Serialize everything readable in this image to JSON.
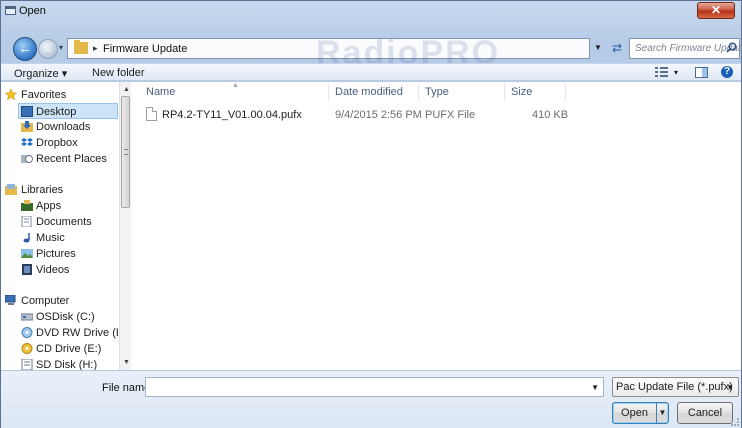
{
  "window": {
    "title": "Open",
    "close_label": "✕"
  },
  "address": {
    "sep": "▸",
    "path": "Firmware Update",
    "watermark": "RadioPRO"
  },
  "search": {
    "placeholder": "Search Firmware Update"
  },
  "toolbar": {
    "organize_label": "Organize ▾",
    "new_folder_label": "New folder"
  },
  "nav": {
    "favorites": "Favorites",
    "favorites_items": [
      "Desktop",
      "Downloads",
      "Dropbox",
      "Recent Places"
    ],
    "libraries": "Libraries",
    "libraries_items": [
      "Apps",
      "Documents",
      "Music",
      "Pictures",
      "Videos"
    ],
    "computer": "Computer",
    "computer_items": [
      "OSDisk (C:)",
      "DVD RW Drive (D",
      "CD Drive (E:)",
      "SD Disk (H:)"
    ]
  },
  "columns": {
    "name": "Name",
    "date": "Date modified",
    "type": "Type",
    "size": "Size"
  },
  "files": [
    {
      "name": "RP4.2-TY11_V01.00.04.pufx",
      "date": "9/4/2015 2:56 PM",
      "type": "PUFX File",
      "size": "410 KB"
    }
  ],
  "bottom": {
    "file_name_label": "File name:",
    "file_name_value": "",
    "filter": "Pac Update File (*.pufx)",
    "open_label": "Open",
    "cancel_label": "Cancel"
  },
  "colors": {
    "accent": "#2f73c4",
    "close": "#c8533a",
    "selection": "#cde4f8"
  }
}
